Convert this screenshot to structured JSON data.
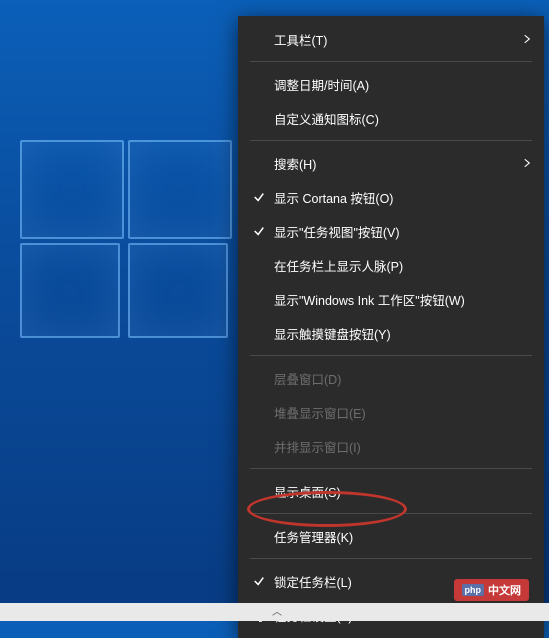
{
  "menu": {
    "toolbars": "工具栏(T)",
    "adjust_date": "调整日期/时间(A)",
    "custom_icons": "自定义通知图标(C)",
    "search": "搜索(H)",
    "show_cortana": "显示 Cortana 按钮(O)",
    "show_taskview": "显示\"任务视图\"按钮(V)",
    "show_people": "在任务栏上显示人脉(P)",
    "show_ink": "显示\"Windows Ink 工作区\"按钮(W)",
    "show_touch_kb": "显示触摸键盘按钮(Y)",
    "cascade": "层叠窗口(D)",
    "stacked": "堆叠显示窗口(E)",
    "sidebyside": "并排显示窗口(I)",
    "show_desktop": "显示桌面(S)",
    "task_manager": "任务管理器(K)",
    "lock_taskbar": "锁定任务栏(L)",
    "taskbar_settings": "任务栏设置(T)"
  },
  "badge": {
    "php": "php",
    "text": "中文网"
  }
}
